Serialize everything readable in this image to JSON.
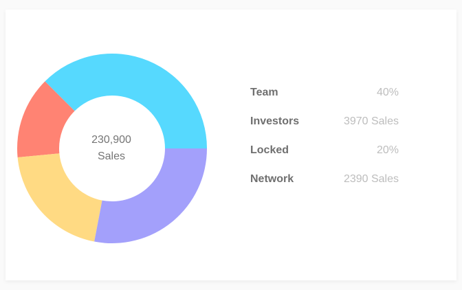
{
  "chart_data": {
    "type": "pie",
    "center": {
      "value": "230,900",
      "label": "Sales"
    },
    "slices": [
      {
        "name": "Team",
        "color": "#56d9fe",
        "fraction": 0.375
      },
      {
        "name": "Network",
        "color": "#ff8373",
        "fraction": 0.14
      },
      {
        "name": "Locked",
        "color": "#ffda83",
        "fraction": 0.205
      },
      {
        "name": "Investors",
        "color": "#a3a0fb",
        "fraction": 0.28
      }
    ],
    "legend": [
      {
        "label": "Team",
        "value": "40%"
      },
      {
        "label": "Investors",
        "value": "3970 Sales"
      },
      {
        "label": "Locked",
        "value": "20%"
      },
      {
        "label": "Network",
        "value": "2390 Sales"
      }
    ]
  }
}
